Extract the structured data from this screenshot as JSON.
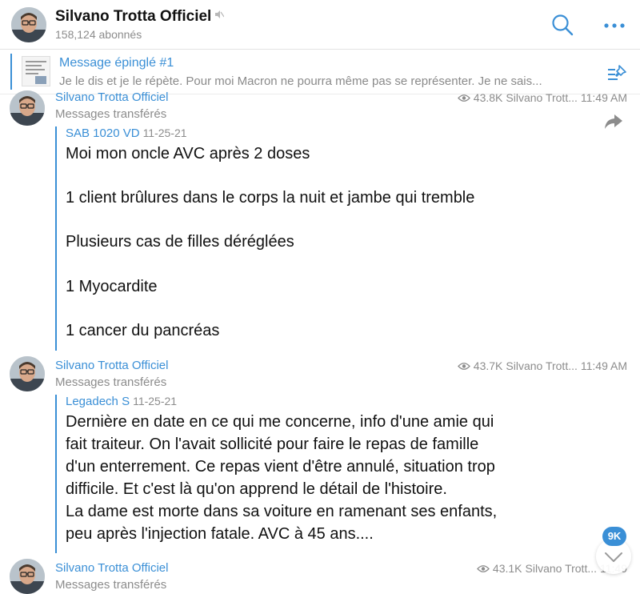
{
  "header": {
    "title": "Silvano Trotta Officiel",
    "subscribers": "158,124 abonnés",
    "mute_icon": "muted-speaker-icon",
    "search_icon": "search-icon",
    "more_icon": "more-dots-icon"
  },
  "pinned": {
    "title": "Message épinglé #1",
    "text": "Je le dis et je le répète. Pour moi Macron ne pourra même pas se représenter. Je ne sais...",
    "icon": "pin-list-icon"
  },
  "messages": [
    {
      "sender": "Silvano Trotta Officiel",
      "forwarded_label": "Messages transférés",
      "views": "43.8K",
      "signature": "Silvano Trott...",
      "time": "11:49 AM",
      "quote_author": "SAB 1020 VD",
      "quote_date": "11-25-21",
      "body": "Moi mon oncle AVC après 2 doses\n\n1 client brûlures dans le corps la nuit et jambe qui tremble\n\nPlusieurs cas de filles déréglées\n\n1 Myocardite\n\n1 cancer du pancréas"
    },
    {
      "sender": "Silvano Trotta Officiel",
      "forwarded_label": "Messages transférés",
      "views": "43.7K",
      "signature": "Silvano Trott...",
      "time": "11:49 AM",
      "quote_author": "Legadech S",
      "quote_date": "11-25-21",
      "body": "Dernière en date en ce qui me concerne, info d'une amie qui\nfait traiteur. On l'avait sollicité pour faire le repas de famille\nd'un enterrement. Ce repas vient d'être annulé, situation trop\ndifficile. Et c'est là qu'on apprend le détail de l'histoire.\nLa dame est morte dans sa voiture en ramenant ses enfants,\npeu après l'injection fatale. AVC à 45 ans...."
    },
    {
      "sender": "Silvano Trotta Officiel",
      "forwarded_label": "Messages transférés",
      "views": "43.1K",
      "signature": "Silvano Trott...",
      "time": "11:49"
    }
  ],
  "floating": {
    "unread_badge": "9K",
    "scroll_icon": "chevron-down-icon",
    "share_icon": "share-arrow-icon"
  },
  "colors": {
    "accent": "#3a8fd6",
    "muted_text": "#8c8c8c"
  }
}
